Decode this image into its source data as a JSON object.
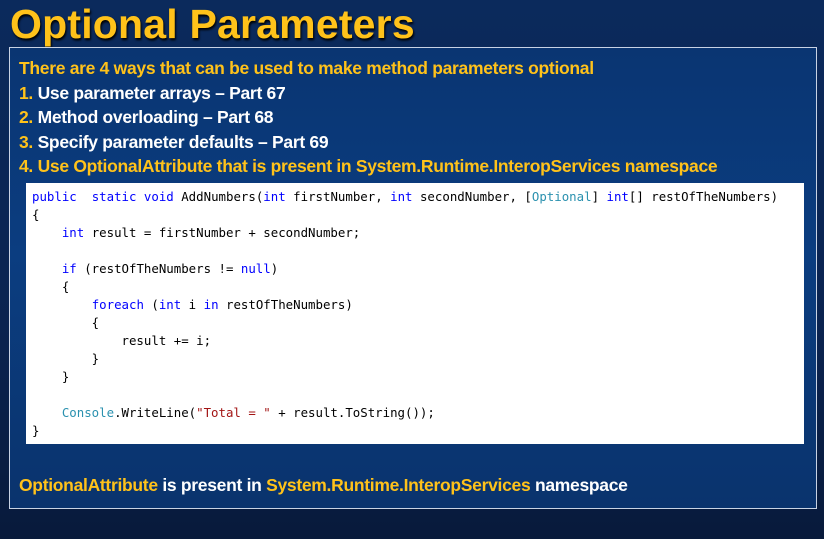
{
  "slide": {
    "title": "Optional Parameters",
    "intro": "There are 4 ways that can be used to make method parameters optional",
    "items": [
      {
        "num": "1.",
        "text": "Use parameter arrays – Part 67"
      },
      {
        "num": "2.",
        "text": "Method overloading – Part 68"
      },
      {
        "num": "3.",
        "text": "Specify parameter defaults – Part 69"
      },
      {
        "num": "4.",
        "text": "Use OptionalAttribute that is present in System.Runtime.InteropServices namespace"
      }
    ],
    "footer": {
      "part1": "OptionalAttribute",
      "part2": " is present in ",
      "part3": "System.Runtime.InteropServices",
      "part4": " namespace"
    }
  },
  "code": {
    "lines": [
      [
        [
          "kw",
          "public"
        ],
        [
          "",
          "  "
        ],
        [
          "kw",
          "static"
        ],
        [
          "",
          " "
        ],
        [
          "kw",
          "void"
        ],
        [
          "",
          " AddNumbers("
        ],
        [
          "kw",
          "int"
        ],
        [
          "",
          " firstNumber, "
        ],
        [
          "kw",
          "int"
        ],
        [
          "",
          " secondNumber, ["
        ],
        [
          "ty",
          "Optional"
        ],
        [
          "",
          "] "
        ],
        [
          "kw",
          "int"
        ],
        [
          "",
          "[] restOfTheNumbers)"
        ]
      ],
      [
        [
          "",
          "{"
        ]
      ],
      [
        [
          "",
          "    "
        ],
        [
          "kw",
          "int"
        ],
        [
          "",
          " result = firstNumber + secondNumber;"
        ]
      ],
      [
        [
          "",
          ""
        ]
      ],
      [
        [
          "",
          "    "
        ],
        [
          "kw",
          "if"
        ],
        [
          "",
          " (restOfTheNumbers != "
        ],
        [
          "kw",
          "null"
        ],
        [
          "",
          ")"
        ]
      ],
      [
        [
          "",
          "    {"
        ]
      ],
      [
        [
          "",
          "        "
        ],
        [
          "kw",
          "foreach"
        ],
        [
          "",
          " ("
        ],
        [
          "kw",
          "int"
        ],
        [
          "",
          " i "
        ],
        [
          "kw",
          "in"
        ],
        [
          "",
          " restOfTheNumbers)"
        ]
      ],
      [
        [
          "",
          "        {"
        ]
      ],
      [
        [
          "",
          "            result += i;"
        ]
      ],
      [
        [
          "",
          "        }"
        ]
      ],
      [
        [
          "",
          "    }"
        ]
      ],
      [
        [
          "",
          ""
        ]
      ],
      [
        [
          "",
          "    "
        ],
        [
          "ty",
          "Console"
        ],
        [
          "",
          ".WriteLine("
        ],
        [
          "st",
          "\"Total = \""
        ],
        [
          "",
          " + result.ToString());"
        ]
      ],
      [
        [
          "",
          "}"
        ]
      ]
    ]
  },
  "colors": {
    "accent": "#ffc21a",
    "text": "#ffffff",
    "background": "#0b3d80",
    "keyword": "#0000ff",
    "type": "#2b91af",
    "string": "#a31515"
  }
}
